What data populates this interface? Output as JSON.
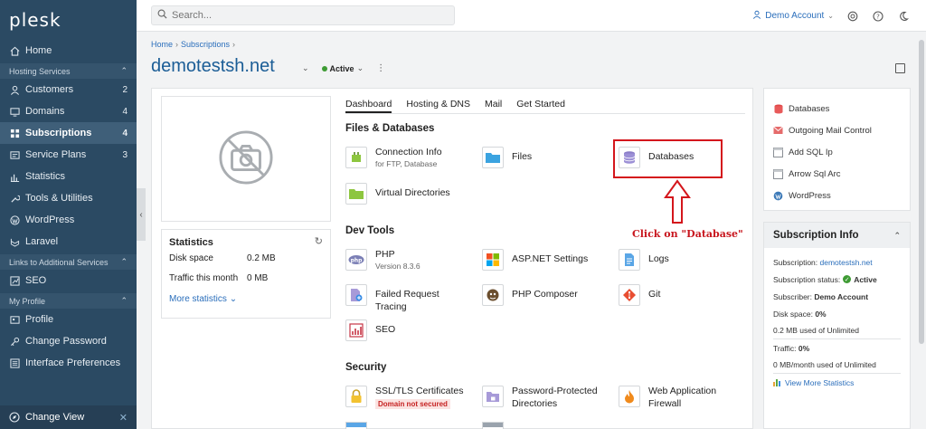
{
  "sidebar": {
    "logo": "plesk",
    "items": [
      {
        "label": "Home",
        "icon": "home-icon"
      },
      {
        "section": "Hosting Services"
      },
      {
        "label": "Customers",
        "count": "2",
        "icon": "user-icon"
      },
      {
        "label": "Domains",
        "count": "4",
        "icon": "monitor-icon"
      },
      {
        "label": "Subscriptions",
        "count": "4",
        "icon": "grid-icon",
        "active": true
      },
      {
        "label": "Service Plans",
        "count": "3",
        "icon": "plan-icon"
      },
      {
        "label": "Statistics",
        "icon": "chart-icon"
      },
      {
        "label": "Tools & Utilities",
        "icon": "tools-icon"
      },
      {
        "label": "WordPress",
        "icon": "wordpress-icon"
      },
      {
        "label": "Laravel",
        "icon": "laravel-icon"
      },
      {
        "section": "Links to Additional Services"
      },
      {
        "label": "SEO",
        "icon": "seo-icon"
      },
      {
        "section": "My Profile"
      },
      {
        "label": "Profile",
        "icon": "profile-icon"
      },
      {
        "label": "Change Password",
        "icon": "key-icon"
      },
      {
        "label": "Interface Preferences",
        "icon": "prefs-icon"
      }
    ],
    "change_view": "Change View"
  },
  "topbar": {
    "search_placeholder": "Search...",
    "account": "Demo Account"
  },
  "breadcrumb": [
    "Home",
    "Subscriptions"
  ],
  "page_title": "demotestsh.net",
  "status": "Active",
  "stats": {
    "title": "Statistics",
    "disk_label": "Disk space",
    "disk_value": "0.2 MB",
    "traffic_label": "Traffic this month",
    "traffic_value": "0 MB",
    "more": "More statistics"
  },
  "tabs": [
    "Dashboard",
    "Hosting & DNS",
    "Mail",
    "Get Started"
  ],
  "sections": {
    "files": "Files & Databases",
    "dev": "Dev Tools",
    "security": "Security"
  },
  "tools": {
    "connection_info": "Connection Info",
    "connection_sub": "for FTP, Database",
    "files": "Files",
    "databases": "Databases",
    "virtual_dirs": "Virtual Directories",
    "php": "PHP",
    "php_sub": "Version 8.3.6",
    "aspnet": "ASP.NET Settings",
    "logs": "Logs",
    "failed_tracing": "Failed Request Tracing",
    "php_composer": "PHP Composer",
    "git": "Git",
    "seo": "SEO",
    "ssl": "SSL/TLS Certificates",
    "ssl_badge": "Domain not secured",
    "pwd_dirs_1": "Password-Protected",
    "pwd_dirs_2": "Directories",
    "waf_1": "Web Application",
    "waf_2": "Firewall"
  },
  "annotation": "Click on \"Database\"",
  "right_links": [
    "Databases",
    "Outgoing Mail Control",
    "Add SQL Ip",
    "Arrow Sql Arc",
    "WordPress"
  ],
  "sub_info": {
    "title": "Subscription Info",
    "subscription_label": "Subscription:",
    "subscription_value": "demotestsh.net",
    "status_label": "Subscription status:",
    "status_value": "Active",
    "subscriber_label": "Subscriber:",
    "subscriber_value": "Demo Account",
    "disk_label": "Disk space:",
    "disk_value": "0%",
    "disk_detail": "0.2 MB used of Unlimited",
    "traffic_label": "Traffic:",
    "traffic_value": "0%",
    "traffic_detail": "0 MB/month used of Unlimited",
    "view_more": "View More Statistics"
  },
  "colors": {
    "sidebar_bg": "#2b4a63",
    "accent_link": "#2a6ebb",
    "highlight_red": "#d4161c"
  }
}
